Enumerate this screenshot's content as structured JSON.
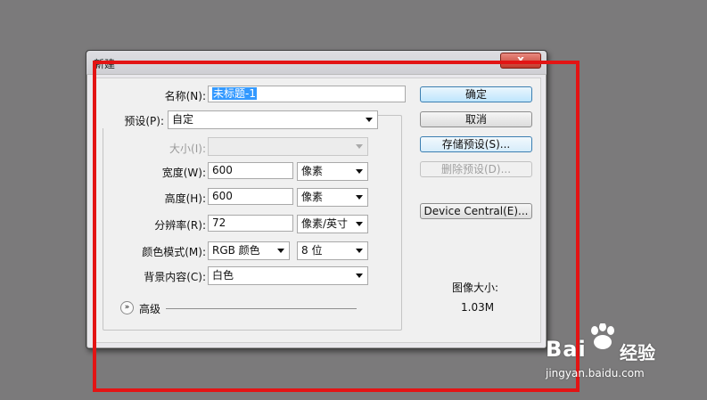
{
  "dialog": {
    "title": "新建",
    "close_label": "x"
  },
  "form": {
    "name_label": "名称(N):",
    "name_value": "未标题-1",
    "preset_label": "预设(P):",
    "preset_value": "自定",
    "size_label": "大小(I):",
    "size_value": "",
    "width_label": "宽度(W):",
    "width_value": "600",
    "width_unit": "像素",
    "height_label": "高度(H):",
    "height_value": "600",
    "height_unit": "像素",
    "resolution_label": "分辨率(R):",
    "resolution_value": "72",
    "resolution_unit": "像素/英寸",
    "color_mode_label": "颜色模式(M):",
    "color_mode_value": "RGB 颜色",
    "bit_depth_value": "8 位",
    "background_label": "背景内容(C):",
    "background_value": "白色",
    "advanced_label": "高级"
  },
  "buttons": {
    "ok": "确定",
    "cancel": "取消",
    "save_preset": "存储预设(S)...",
    "delete_preset": "删除预设(D)...",
    "device_central": "Device Central(E)..."
  },
  "image_size": {
    "label": "图像大小:",
    "value": "1.03M"
  },
  "watermark": {
    "brand": "Bai",
    "brand_suffix": "经验",
    "url": "jingyan.baidu.com"
  }
}
